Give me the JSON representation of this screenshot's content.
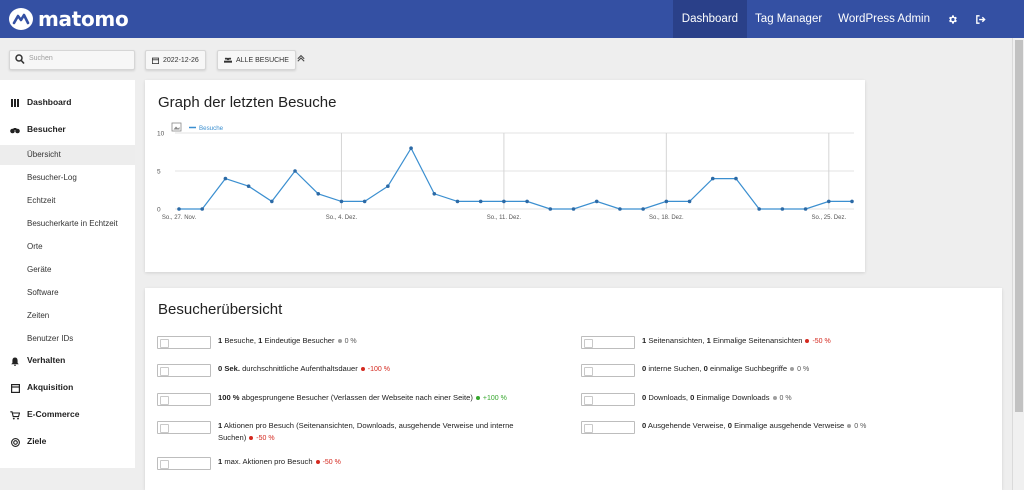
{
  "app": {
    "brand": "matomo"
  },
  "topnav": {
    "items": [
      {
        "label": "Dashboard",
        "active": true
      },
      {
        "label": "Tag Manager",
        "active": false
      },
      {
        "label": "WordPress Admin",
        "active": false
      }
    ],
    "icons": [
      "gear-icon",
      "logout-icon"
    ]
  },
  "filter": {
    "search_placeholder": "Suchen",
    "date": "2022-12-26",
    "segment": "ALLE BESUCHE"
  },
  "sidebar": {
    "dashboard": "Dashboard",
    "visitors": "Besucher",
    "visitor_items": [
      "Übersicht",
      "Besucher-Log",
      "Echtzeit",
      "Besucherkarte in Echtzeit",
      "Orte",
      "Geräte",
      "Software",
      "Zeiten",
      "Benutzer IDs"
    ],
    "behaviour": "Verhalten",
    "acquisition": "Akquisition",
    "ecommerce": "E-Commerce",
    "goals": "Ziele"
  },
  "graph_card": {
    "title": "Graph der letzten Besuche",
    "legend": "Besuche"
  },
  "chart_data": {
    "type": "line",
    "series": [
      {
        "name": "Besuche",
        "values": [
          0,
          0,
          4,
          3,
          1,
          5,
          2,
          1,
          1,
          3,
          8,
          2,
          1,
          1,
          1,
          1,
          0,
          0,
          1,
          0,
          0,
          1,
          1,
          4,
          4,
          0,
          0,
          0,
          1,
          1
        ]
      }
    ],
    "x_tick_labels": [
      "So., 27. Nov.",
      "So., 4. Dez.",
      "So., 11. Dez.",
      "So., 18. Dez.",
      "So., 25. Dez."
    ],
    "y_tick_labels": [
      "0",
      "5",
      "10"
    ],
    "ylim": [
      0,
      10
    ],
    "color": "#3b8fd0",
    "grid": true
  },
  "overview_card": {
    "title": "Besucherübersicht",
    "left": [
      {
        "parts": [
          [
            "1",
            true
          ],
          [
            " Besuche, ",
            false
          ],
          [
            "1",
            true
          ],
          [
            " Eindeutige Besucher",
            false
          ]
        ],
        "change": "0 %",
        "trend": "neutral"
      },
      {
        "parts": [
          [
            "0 Sek.",
            true
          ],
          [
            " durchschnittliche Aufenthaltsdauer",
            false
          ]
        ],
        "change": "-100 %",
        "trend": "neg"
      },
      {
        "parts": [
          [
            "100 %",
            true
          ],
          [
            " abgesprungene Besucher (Verlassen der Webseite nach einer Seite)",
            false
          ]
        ],
        "change": "+100 %",
        "trend": "pos"
      },
      {
        "parts": [
          [
            "1",
            true
          ],
          [
            " Aktionen pro Besuch (Seitenansichten, Downloads, ausgehende Verweise und interne Suchen)",
            false
          ]
        ],
        "change": "-50 %",
        "trend": "neg"
      },
      {
        "parts": [
          [
            "1",
            true
          ],
          [
            " max. Aktionen pro Besuch",
            false
          ]
        ],
        "change": "-50 %",
        "trend": "neg"
      }
    ],
    "right": [
      {
        "parts": [
          [
            "1",
            true
          ],
          [
            " Seitenansichten, ",
            false
          ],
          [
            "1",
            true
          ],
          [
            " Einmalige Seitenansichten",
            false
          ]
        ],
        "change": "-50 %",
        "trend": "neg"
      },
      {
        "parts": [
          [
            "0",
            true
          ],
          [
            " interne Suchen, ",
            false
          ],
          [
            "0",
            true
          ],
          [
            " einmalige Suchbegriffe",
            false
          ]
        ],
        "change": "0 %",
        "trend": "neutral"
      },
      {
        "parts": [
          [
            "0",
            true
          ],
          [
            " Downloads, ",
            false
          ],
          [
            "0",
            true
          ],
          [
            " Einmalige Downloads",
            false
          ]
        ],
        "change": "0 %",
        "trend": "neutral"
      },
      {
        "parts": [
          [
            "0",
            true
          ],
          [
            " Ausgehende Verweise, ",
            false
          ],
          [
            "0",
            true
          ],
          [
            " Einmalige ausgehende Verweise",
            false
          ]
        ],
        "change": "0 %",
        "trend": "neutral"
      }
    ],
    "colors": {
      "neg": "#d4291f",
      "pos": "#36a72d",
      "neutral": "#9e9e9e"
    }
  }
}
